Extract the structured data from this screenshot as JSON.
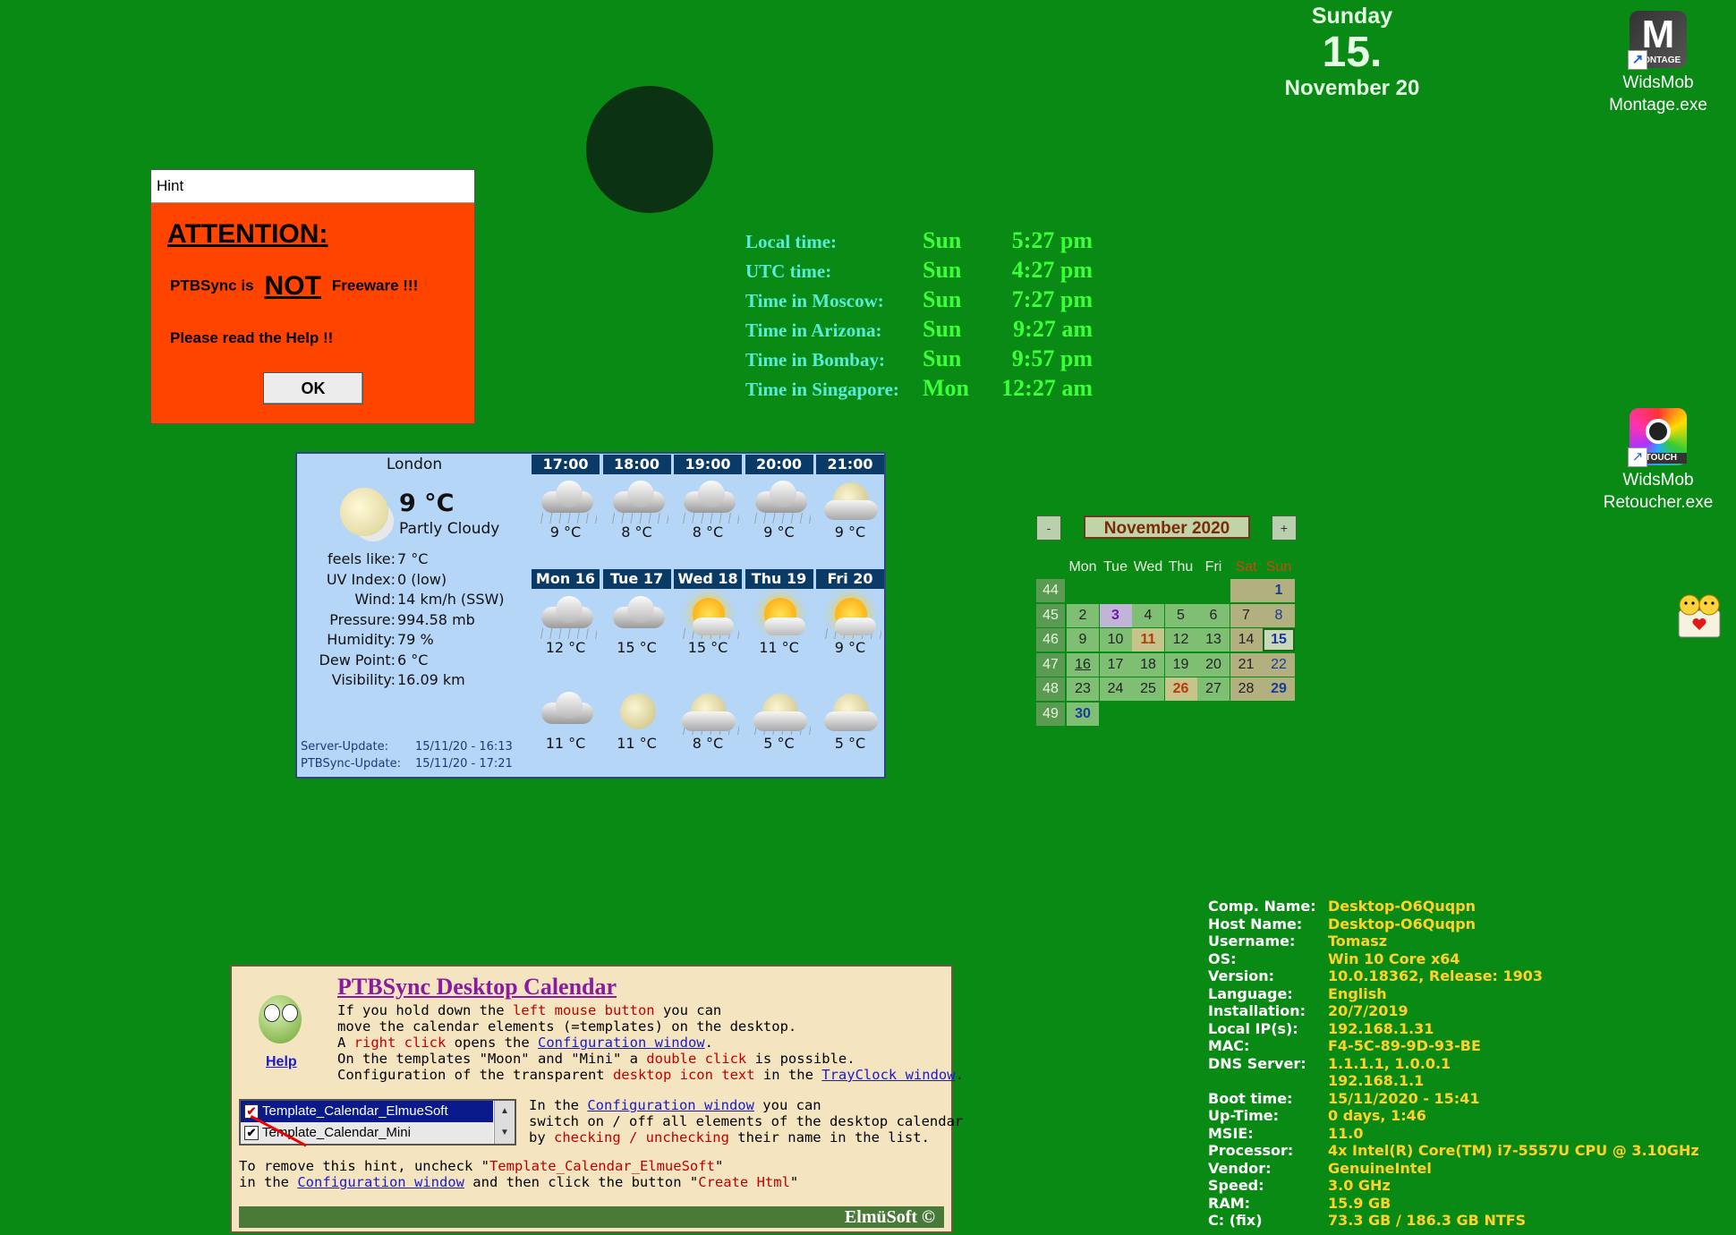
{
  "date": {
    "weekday": "Sunday",
    "day": "15.",
    "month": "November 20"
  },
  "icons": {
    "montage": {
      "line1": "WidsMob",
      "line2": "Montage.exe",
      "badge": "MONTAGE",
      "glyph": "M"
    },
    "retoucher": {
      "line1": "WidsMob",
      "line2": "Retoucher.exe",
      "badge": "ETOUCH"
    }
  },
  "hint": {
    "title": "Hint",
    "attention": "ATTENTION:",
    "line1_a": "PTBSync is",
    "line1_not": "NOT",
    "line1_b": "Freeware !!!",
    "line2": "Please read the Help !!",
    "ok": "OK"
  },
  "clocks": [
    {
      "label": "Local time:",
      "day": "Sun",
      "time": "5:27 pm"
    },
    {
      "label": "UTC time:",
      "day": "Sun",
      "time": "4:27 pm"
    },
    {
      "label": "Time in Moscow:",
      "day": "Sun",
      "time": "7:27 pm"
    },
    {
      "label": "Time in Arizona:",
      "day": "Sun",
      "time": "9:27 am"
    },
    {
      "label": "Time in Bombay:",
      "day": "Sun",
      "time": "9:57 pm"
    },
    {
      "label": "Time in Singapore:",
      "day": "Mon",
      "time": "12:27 am"
    }
  ],
  "weather": {
    "city": "London",
    "temp": "9 °C",
    "desc": "Partly Cloudy",
    "details": [
      {
        "k": "feels like:",
        "v": "7 °C"
      },
      {
        "k": "UV Index:",
        "v": "0 (low)"
      },
      {
        "k": "Wind:",
        "v": "14 km/h (SSW)"
      },
      {
        "k": "Pressure:",
        "v": "994.58 mb"
      },
      {
        "k": "Humidity:",
        "v": "79 %"
      },
      {
        "k": "Dew Point:",
        "v": "6 °C"
      },
      {
        "k": "Visibility:",
        "v": "16.09 km"
      }
    ],
    "server_update_label": "Server-Update:",
    "server_update": "15/11/20 - 16:13",
    "ptb_update_label": "PTBSync-Update:",
    "ptb_update": "15/11/20 - 17:21",
    "hours": [
      "17:00",
      "18:00",
      "19:00",
      "20:00",
      "21:00"
    ],
    "hour_cells": [
      {
        "icon": "cloud-rain",
        "t": "9 °C"
      },
      {
        "icon": "cloud-rain",
        "t": "8 °C"
      },
      {
        "icon": "cloud-rain",
        "t": "8 °C"
      },
      {
        "icon": "cloud-rain",
        "t": "9 °C"
      },
      {
        "icon": "moon-cloud",
        "t": "9 °C"
      }
    ],
    "days": [
      "Mon 16",
      "Tue 17",
      "Wed 18",
      "Thu 19",
      "Fri 20"
    ],
    "day_cells": [
      {
        "icon": "cloud-rain",
        "t": "12 °C"
      },
      {
        "icon": "cloud",
        "t": "15 °C"
      },
      {
        "icon": "sun-cloud-rain",
        "t": "15 °C"
      },
      {
        "icon": "sun-cloud",
        "t": "11 °C"
      },
      {
        "icon": "sun-cloud-rain",
        "t": "9 °C"
      }
    ],
    "night_cells": [
      {
        "icon": "cloud",
        "t": "11 °C"
      },
      {
        "icon": "moon",
        "t": "11 °C"
      },
      {
        "icon": "moon-cloud-rain",
        "t": "8 °C"
      },
      {
        "icon": "moon-cloud-rain",
        "t": "5 °C"
      },
      {
        "icon": "moon-cloud",
        "t": "5 °C"
      }
    ]
  },
  "calendar": {
    "title": "November 2020",
    "prev": "-",
    "next": "+",
    "weekdays": [
      "Mon",
      "Tue",
      "Wed",
      "Thu",
      "Fri",
      "Sat",
      "Sun"
    ],
    "weeks": [
      {
        "wk": "44",
        "days": [
          "",
          "",
          "",
          "",
          "",
          "",
          "1"
        ]
      },
      {
        "wk": "45",
        "days": [
          "2",
          "3",
          "4",
          "5",
          "6",
          "7",
          "8"
        ]
      },
      {
        "wk": "46",
        "days": [
          "9",
          "10",
          "11",
          "12",
          "13",
          "14",
          "15"
        ]
      },
      {
        "wk": "47",
        "days": [
          "16",
          "17",
          "18",
          "19",
          "20",
          "21",
          "22"
        ]
      },
      {
        "wk": "48",
        "days": [
          "23",
          "24",
          "25",
          "26",
          "27",
          "28",
          "29"
        ]
      },
      {
        "wk": "49",
        "days": [
          "30",
          "",
          "",
          "",
          "",
          "",
          ""
        ]
      }
    ]
  },
  "sysinfo": [
    {
      "k": "Comp. Name:",
      "v": "Desktop-O6Quqpn"
    },
    {
      "k": "Host Name:",
      "v": "Desktop-O6Quqpn"
    },
    {
      "k": "Username:",
      "v": "Tomasz"
    },
    {
      "k": "OS:",
      "v": "Win 10 Core x64"
    },
    {
      "k": "Version:",
      "v": "10.0.18362, Release: 1903"
    },
    {
      "k": "Language:",
      "v": "English"
    },
    {
      "k": "Installation:",
      "v": "20/7/2019"
    },
    {
      "k": "Local IP(s):",
      "v": "192.168.1.31"
    },
    {
      "k": "MAC:",
      "v": "F4-5C-89-9D-93-BE"
    },
    {
      "k": "DNS Server:",
      "v": "1.1.1.1, 1.0.0.1"
    },
    {
      "k": "",
      "v": "192.168.1.1"
    },
    {
      "k": "Boot time:",
      "v": "15/11/2020 - 15:41"
    },
    {
      "k": "Up-Time:",
      "v": "0 days, 1:46"
    },
    {
      "k": "MSIE:",
      "v": "11.0"
    },
    {
      "k": "Processor:",
      "v": "4x Intel(R) Core(TM) i7-5557U CPU @ 3.10GHz"
    },
    {
      "k": "Vendor:",
      "v": "GenuineIntel"
    },
    {
      "k": "Speed:",
      "v": "3.0 GHz"
    },
    {
      "k": "RAM:",
      "v": "15.9 GB"
    },
    {
      "k": "C: (fix)",
      "v": "73.3 GB / 186.3 GB  NTFS"
    }
  ],
  "ptb": {
    "title": "PTBSync Desktop Calendar",
    "help": "Help",
    "l1": [
      "If you hold down the ",
      "left mouse button",
      " you can"
    ],
    "l2": "move the calendar elements (=templates) on the desktop.",
    "l3": [
      "A ",
      "right click",
      " opens the ",
      "Configuration window",
      "."
    ],
    "l4": [
      "On the templates \"Moon\" and \"Mini\" a ",
      "double click",
      " is possible."
    ],
    "l5": [
      "Configuration of the transparent ",
      "desktop icon text",
      " in the ",
      "TrayClock window",
      "."
    ],
    "list": [
      "Template_Calendar_ElmueSoft",
      "Template_Calendar_Mini"
    ],
    "r1": [
      "In the ",
      "Configuration window",
      " you can"
    ],
    "r2": "switch on / off all elements of the desktop calendar",
    "r3": [
      "by ",
      "checking / unchecking",
      " their name in the list."
    ],
    "b1": [
      "To remove this hint, uncheck \"",
      "Template_Calendar_ElmueSoft",
      "\""
    ],
    "b2": [
      "in the ",
      "Configuration window",
      " and then click the button \"",
      "Create Html",
      "\""
    ],
    "footer": "ElmüSoft ©"
  }
}
